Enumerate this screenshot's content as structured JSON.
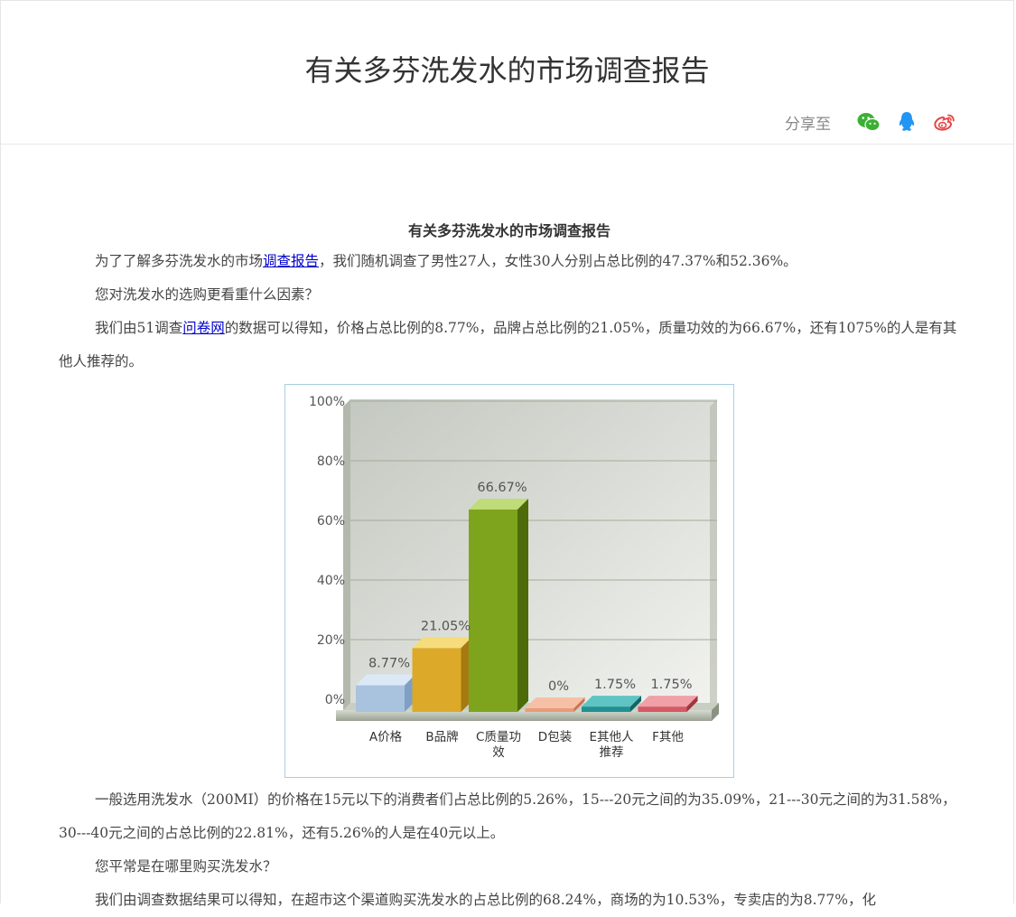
{
  "page": {
    "title": "有关多芬洗发水的市场调查报告",
    "share_label": "分享至",
    "share_icons": [
      "wechat-icon",
      "qq-icon",
      "weibo-icon"
    ]
  },
  "article": {
    "heading": "有关多芬洗发水的市场调查报告",
    "p1_before": "为了了解多芬洗发水的市场",
    "p1_link": "调查报告",
    "p1_after": "，我们随机调查了男性27人，女性30人分别占总比例的47.37%和52.36%。",
    "p2": "您对洗发水的选购更看重什么因素？",
    "p3_before": "我们由51调查",
    "p3_link": "问卷网",
    "p3_after": "的数据可以得知，价格占总比例的8.77%，品牌占总比例的21.05%，质量功效的为66.67%，还有1075%的人是有其他人推荐的。",
    "p4": "一般选用洗发水（200MI）的价格在15元以下的消费者们占总比例的5.26%，15---20元之间的为35.09%，21---30元之间的为31.58%，30---40元之间的占总比例的22.81%，还有5.26%的人是在40元以上。",
    "p5": "您平常是在哪里购买洗发水？",
    "p6": "我们由调查数据结果可以得知，在超市这个渠道购买洗发水的占总比例的68.24%，商场的为10.53%，专卖店的为8.77%，化"
  },
  "chart_data": {
    "type": "bar",
    "categories": [
      "A价格",
      "B品牌",
      "C质量功效",
      "D包装",
      "E其他人推荐",
      "F其他"
    ],
    "category_lines": [
      [
        "A价格"
      ],
      [
        "B品牌"
      ],
      [
        "C质量功",
        "效"
      ],
      [
        "D包装"
      ],
      [
        "E其他人",
        "推荐"
      ],
      [
        "F其他"
      ]
    ],
    "values": [
      8.77,
      21.05,
      66.67,
      0,
      1.75,
      1.75
    ],
    "value_labels": [
      "8.77%",
      "21.05%",
      "66.67%",
      "0%",
      "1.75%",
      "1.75%"
    ],
    "y_ticks": [
      "0%",
      "20%",
      "40%",
      "60%",
      "80%",
      "100%"
    ],
    "ylim": [
      0,
      100
    ],
    "grid": true,
    "colors": [
      [
        "#dbe8f6",
        "#a9c3df",
        "#7f9fc4"
      ],
      [
        "#f6dc7a",
        "#dcaa28",
        "#a57a10"
      ],
      [
        "#bfdc78",
        "#7ea41e",
        "#4e6b0a"
      ],
      [
        "#f6c0a6",
        "#eb9a78",
        "#c97052"
      ],
      [
        "#5ec3c3",
        "#228f91",
        "#136466"
      ],
      [
        "#f0a0a6",
        "#d45a63",
        "#a3343d"
      ]
    ]
  }
}
